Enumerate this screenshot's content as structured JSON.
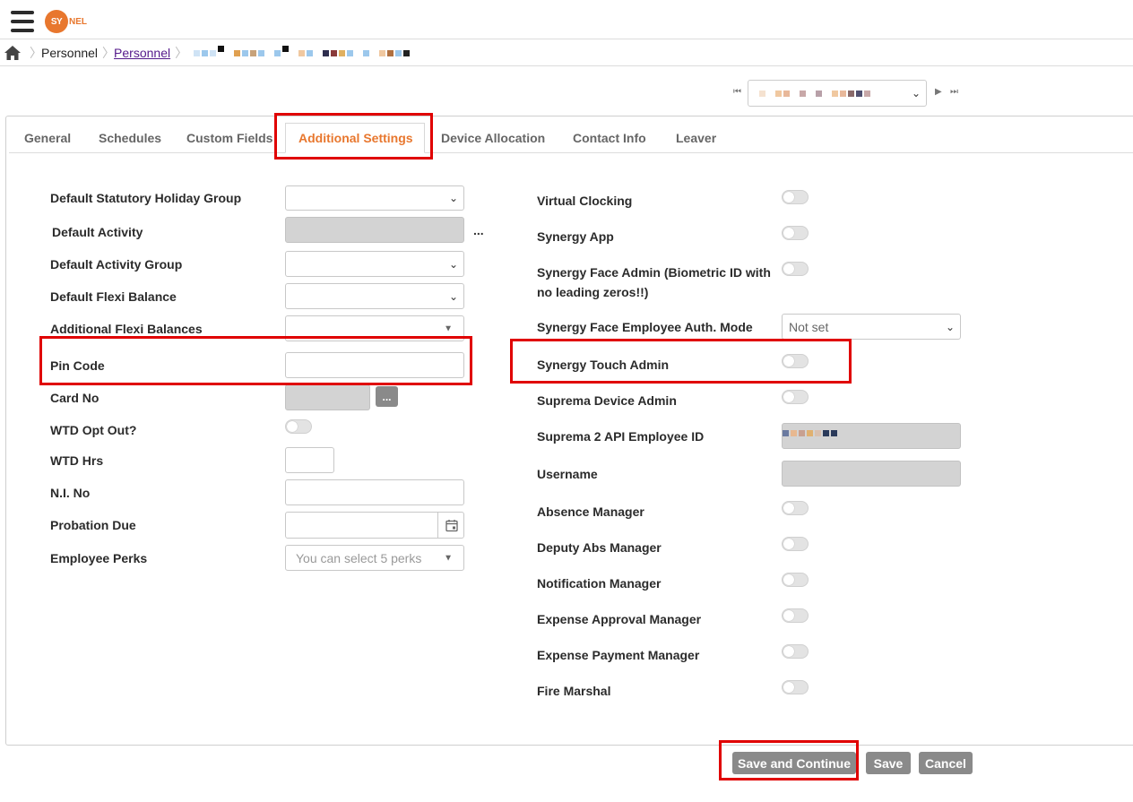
{
  "header": {
    "logo_text_main": "SY",
    "logo_text_tail": "NEL"
  },
  "breadcrumb": {
    "item1": "Personnel",
    "item2": "Personnel"
  },
  "tabs": [
    "General",
    "Schedules",
    "Custom Fields",
    "Additional Settings",
    "Device Allocation",
    "Contact Info",
    "Leaver"
  ],
  "left_fields": {
    "statutory_holiday_group": "Default Statutory Holiday Group",
    "default_activity": "Default Activity",
    "activity_group": "Default Activity Group",
    "flexi_balance": "Default Flexi Balance",
    "additional_flexi": "Additional Flexi Balances",
    "pin_code": "Pin Code",
    "card_no": "Card No",
    "wtd_opt_out": "WTD Opt Out?",
    "wtd_hrs": "WTD Hrs",
    "ni_no": "N.I. No",
    "probation_due": "Probation Due",
    "employee_perks": "Employee Perks",
    "perks_placeholder": "You can select 5 perks",
    "ellipsis": "...",
    "dots_btn": "..."
  },
  "right_fields": {
    "virtual_clocking": "Virtual Clocking",
    "synergy_app": "Synergy App",
    "face_admin_line1": "Synergy Face Admin (Biometric ID with",
    "face_admin_line2": "no leading zeros!!)",
    "face_emp_auth": "Synergy Face Employee Auth. Mode",
    "face_emp_auth_value": "Not set",
    "touch_admin": "Synergy Touch Admin",
    "suprema_admin": "Suprema Device Admin",
    "suprema_api": "Suprema 2 API Employee ID",
    "username": "Username",
    "absence_manager": "Absence Manager",
    "deputy_abs_manager": "Deputy Abs Manager",
    "notification_manager": "Notification Manager",
    "expense_approval": "Expense Approval Manager",
    "expense_payment": "Expense Payment Manager",
    "fire_marshal": "Fire Marshal"
  },
  "buttons": {
    "save_continue": "Save and Continue",
    "save": "Save",
    "cancel": "Cancel"
  },
  "colors": {
    "accent": "#e8772e",
    "highlight": "#e00000",
    "button": "#8a8a8a"
  }
}
